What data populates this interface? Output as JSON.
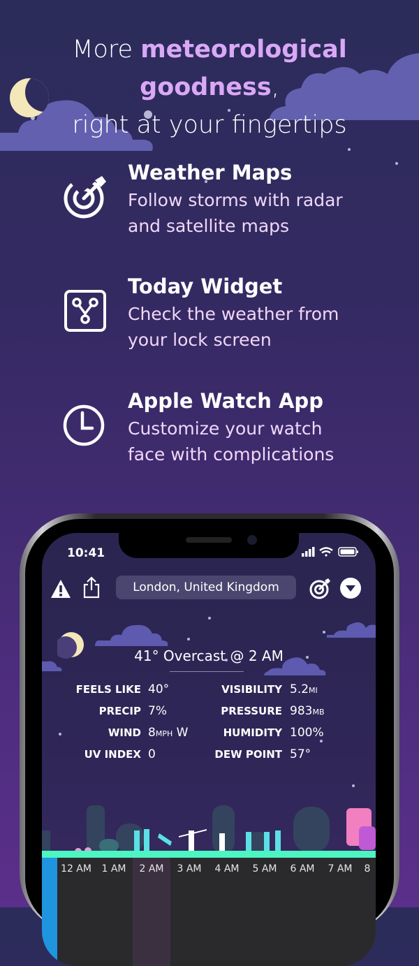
{
  "headline": {
    "prefix": "More ",
    "accent": "meteorological goodness",
    "suffix": ",",
    "line2": "right at your fingertips"
  },
  "features": [
    {
      "icon": "radar-icon",
      "title": "Weather Maps",
      "line1": "Follow storms with radar",
      "line2": "and satellite maps"
    },
    {
      "icon": "widget-icon",
      "title": "Today Widget",
      "line1": "Check the weather from",
      "line2": "your lock screen"
    },
    {
      "icon": "clock-icon",
      "title": "Apple Watch App",
      "line1": "Customize your watch",
      "line2": "face with complications"
    }
  ],
  "phone": {
    "status_time": "10:41",
    "location": "London, United Kingdom",
    "condition": "41° Overcast @ 2 AM",
    "stats_left": [
      {
        "label": "FEELS LIKE",
        "value": "40°",
        "unit": ""
      },
      {
        "label": "PRECIP",
        "value": "7%",
        "unit": ""
      },
      {
        "label": "WIND",
        "value": "8",
        "unit": "MPH",
        "suffix": " W"
      },
      {
        "label": "UV INDEX",
        "value": "0",
        "unit": ""
      }
    ],
    "stats_right": [
      {
        "label": "VISIBILITY",
        "value": "5.2",
        "unit": "MI"
      },
      {
        "label": "PRESSURE",
        "value": "983",
        "unit": "MB"
      },
      {
        "label": "HUMIDITY",
        "value": "100%",
        "unit": ""
      },
      {
        "label": "DEW POINT",
        "value": "57°",
        "unit": ""
      }
    ],
    "hours": [
      "12 AM",
      "1 AM",
      "2 AM",
      "3 AM",
      "4 AM",
      "5 AM",
      "6 AM",
      "7 AM",
      "8"
    ]
  },
  "colors": {
    "accent": "#d9a8f6",
    "ground": "#4cf5c1",
    "now_bar": "#1f95e0",
    "selected_hour": "#3b3040"
  }
}
